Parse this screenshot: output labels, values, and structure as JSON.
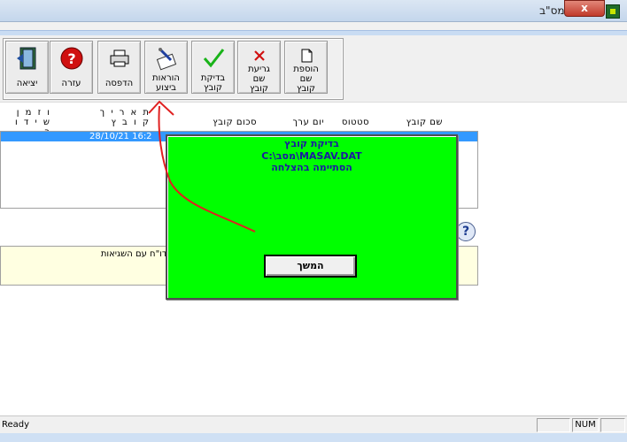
{
  "window": {
    "title": "מערכת מס\"ב",
    "close_label": "x"
  },
  "toolbar": {
    "buttons": [
      {
        "label": "יציאה",
        "icon": "exit-door-icon"
      },
      {
        "label": "עזרה",
        "icon": "help-question-icon"
      },
      {
        "label": "הדפסה",
        "icon": "printer-icon"
      },
      {
        "label_l1": "הוראות",
        "label_l2": "ביצוע",
        "icon": "instructions-pen-icon"
      },
      {
        "label_l1": "בדיקת",
        "label_l2": "קובץ",
        "icon": "check-mark-icon"
      },
      {
        "label_l1": "גריעת",
        "label_l2": "שם",
        "label_l3": "קובץ",
        "icon": "delete-x-icon"
      },
      {
        "label_l1": "הוספת",
        "label_l2": "שם",
        "label_l3": "קובץ",
        "icon": "new-file-icon"
      }
    ]
  },
  "columns": {
    "time_l1": "ו ז מ ן",
    "time_l2": "ש י ד ו ר",
    "date_l1": "ת א ר י ך",
    "date_l2": "ק ו ב ץ",
    "sum": "סכום קובץ",
    "value_day": "יום ערך",
    "status": "סטטוס",
    "file_name": "שם קובץ"
  },
  "list": {
    "selected_row_text": "28/10/21  16:2"
  },
  "errors_panel": {
    "label": "קרן דו\"ח עם השגיאות"
  },
  "dialog": {
    "title": "בדיקת קובץ",
    "file": "C:\\מסב\\MASAV.DAT",
    "message": "הסתיימה בהצלחה",
    "continue_label": "המשך"
  },
  "status": {
    "ready": "Ready",
    "num": "NUM"
  },
  "colors": {
    "dialog_bg": "#00ff00",
    "selection": "#3399ff",
    "errors_bg": "#ffffe1",
    "annotation": "#e02020"
  }
}
